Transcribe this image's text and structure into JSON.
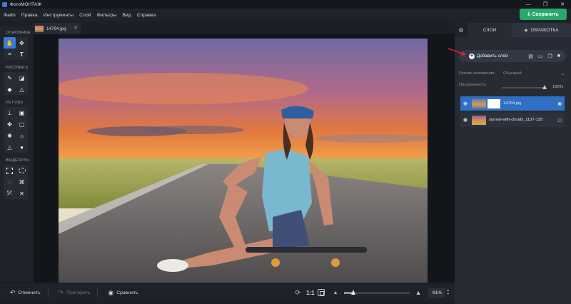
{
  "app": {
    "title": "ФотоМОНТАЖ"
  },
  "window_controls": {
    "minimize": "—",
    "maximize": "❐",
    "close": "✕"
  },
  "menu": {
    "items": [
      "Файл",
      "Правка",
      "Инструменты",
      "Слой",
      "Фильтры",
      "Вид",
      "Справка"
    ],
    "save_label": "Сохранить",
    "save_color": "#28a86a"
  },
  "document_tab": {
    "name": "14794.jpg",
    "close": "✕"
  },
  "toolbox": {
    "sections": [
      {
        "title": "ОСНОВНЫЕ",
        "tools": [
          "hand-icon",
          "move-icon",
          "crop-icon",
          "text-icon"
        ]
      },
      {
        "title": "РИСОВАТЬ",
        "tools": [
          "brush-icon",
          "eraser-icon",
          "fill-icon",
          "shapes-icon"
        ]
      },
      {
        "title": "РЕТУШЬ",
        "tools": [
          "stamp-icon",
          "patch-icon",
          "healing-icon",
          "frame-icon",
          "blur-icon",
          "brightness-icon",
          "sharpen-icon",
          "drop-icon"
        ]
      },
      {
        "title": "ВЫДЕЛИТЬ",
        "tools": [
          "rect-select-icon",
          "ellipse-select-icon",
          "lasso-icon",
          "poly-lasso-icon",
          "magnetic-lasso-icon",
          "magic-wand-icon"
        ]
      }
    ],
    "glyphs": {
      "hand": "✋",
      "move": "✥",
      "crop": "⌗",
      "text": "T",
      "brush": "✎",
      "eraser": "◪",
      "fill": "◆",
      "shapes": "△",
      "stamp": "⊥",
      "patch": "▣",
      "healing": "✤",
      "frame": "▢",
      "blur": "✺",
      "brightness": "☼",
      "sharpen": "△",
      "drop": "●",
      "lasso": "◌",
      "poly_lasso": "⌘",
      "magnetic": "⤱",
      "wand": "✕"
    }
  },
  "statusbar": {
    "undo": "Отменить",
    "redo": "Повторить",
    "compare": "Сравнить",
    "undo_glyph": "↶",
    "redo_glyph": "↷",
    "compare_glyph": "◉",
    "ratio": "1:1",
    "rotate_glyph": "⟳",
    "zoom": "61%",
    "zoom_level": 0.15
  },
  "right_panel": {
    "tabs": {
      "layers": "СЛОИ",
      "processing": "ОБРАБОТКА"
    },
    "settings_glyph": "⚙",
    "processing_glyph": "◈",
    "add_layer": "Добавить слой",
    "ops": [
      "▤",
      "▭",
      "❐",
      "■"
    ],
    "blend_label": "Режим наложения:",
    "blend_value": "Обычный",
    "opacity_label": "Прозрачность",
    "opacity_value": "100%",
    "opacity_level": 1.0,
    "layers": [
      {
        "name": "14794.jpg",
        "selected": true,
        "locked": true,
        "has_mask": true
      },
      {
        "name": "sunset-with-clouds_1137-135",
        "selected": false,
        "locked": false,
        "has_mask": false
      }
    ],
    "selected_color": "#2f6fc4",
    "eye_glyph": "◉",
    "lock_glyph": "🔒"
  }
}
